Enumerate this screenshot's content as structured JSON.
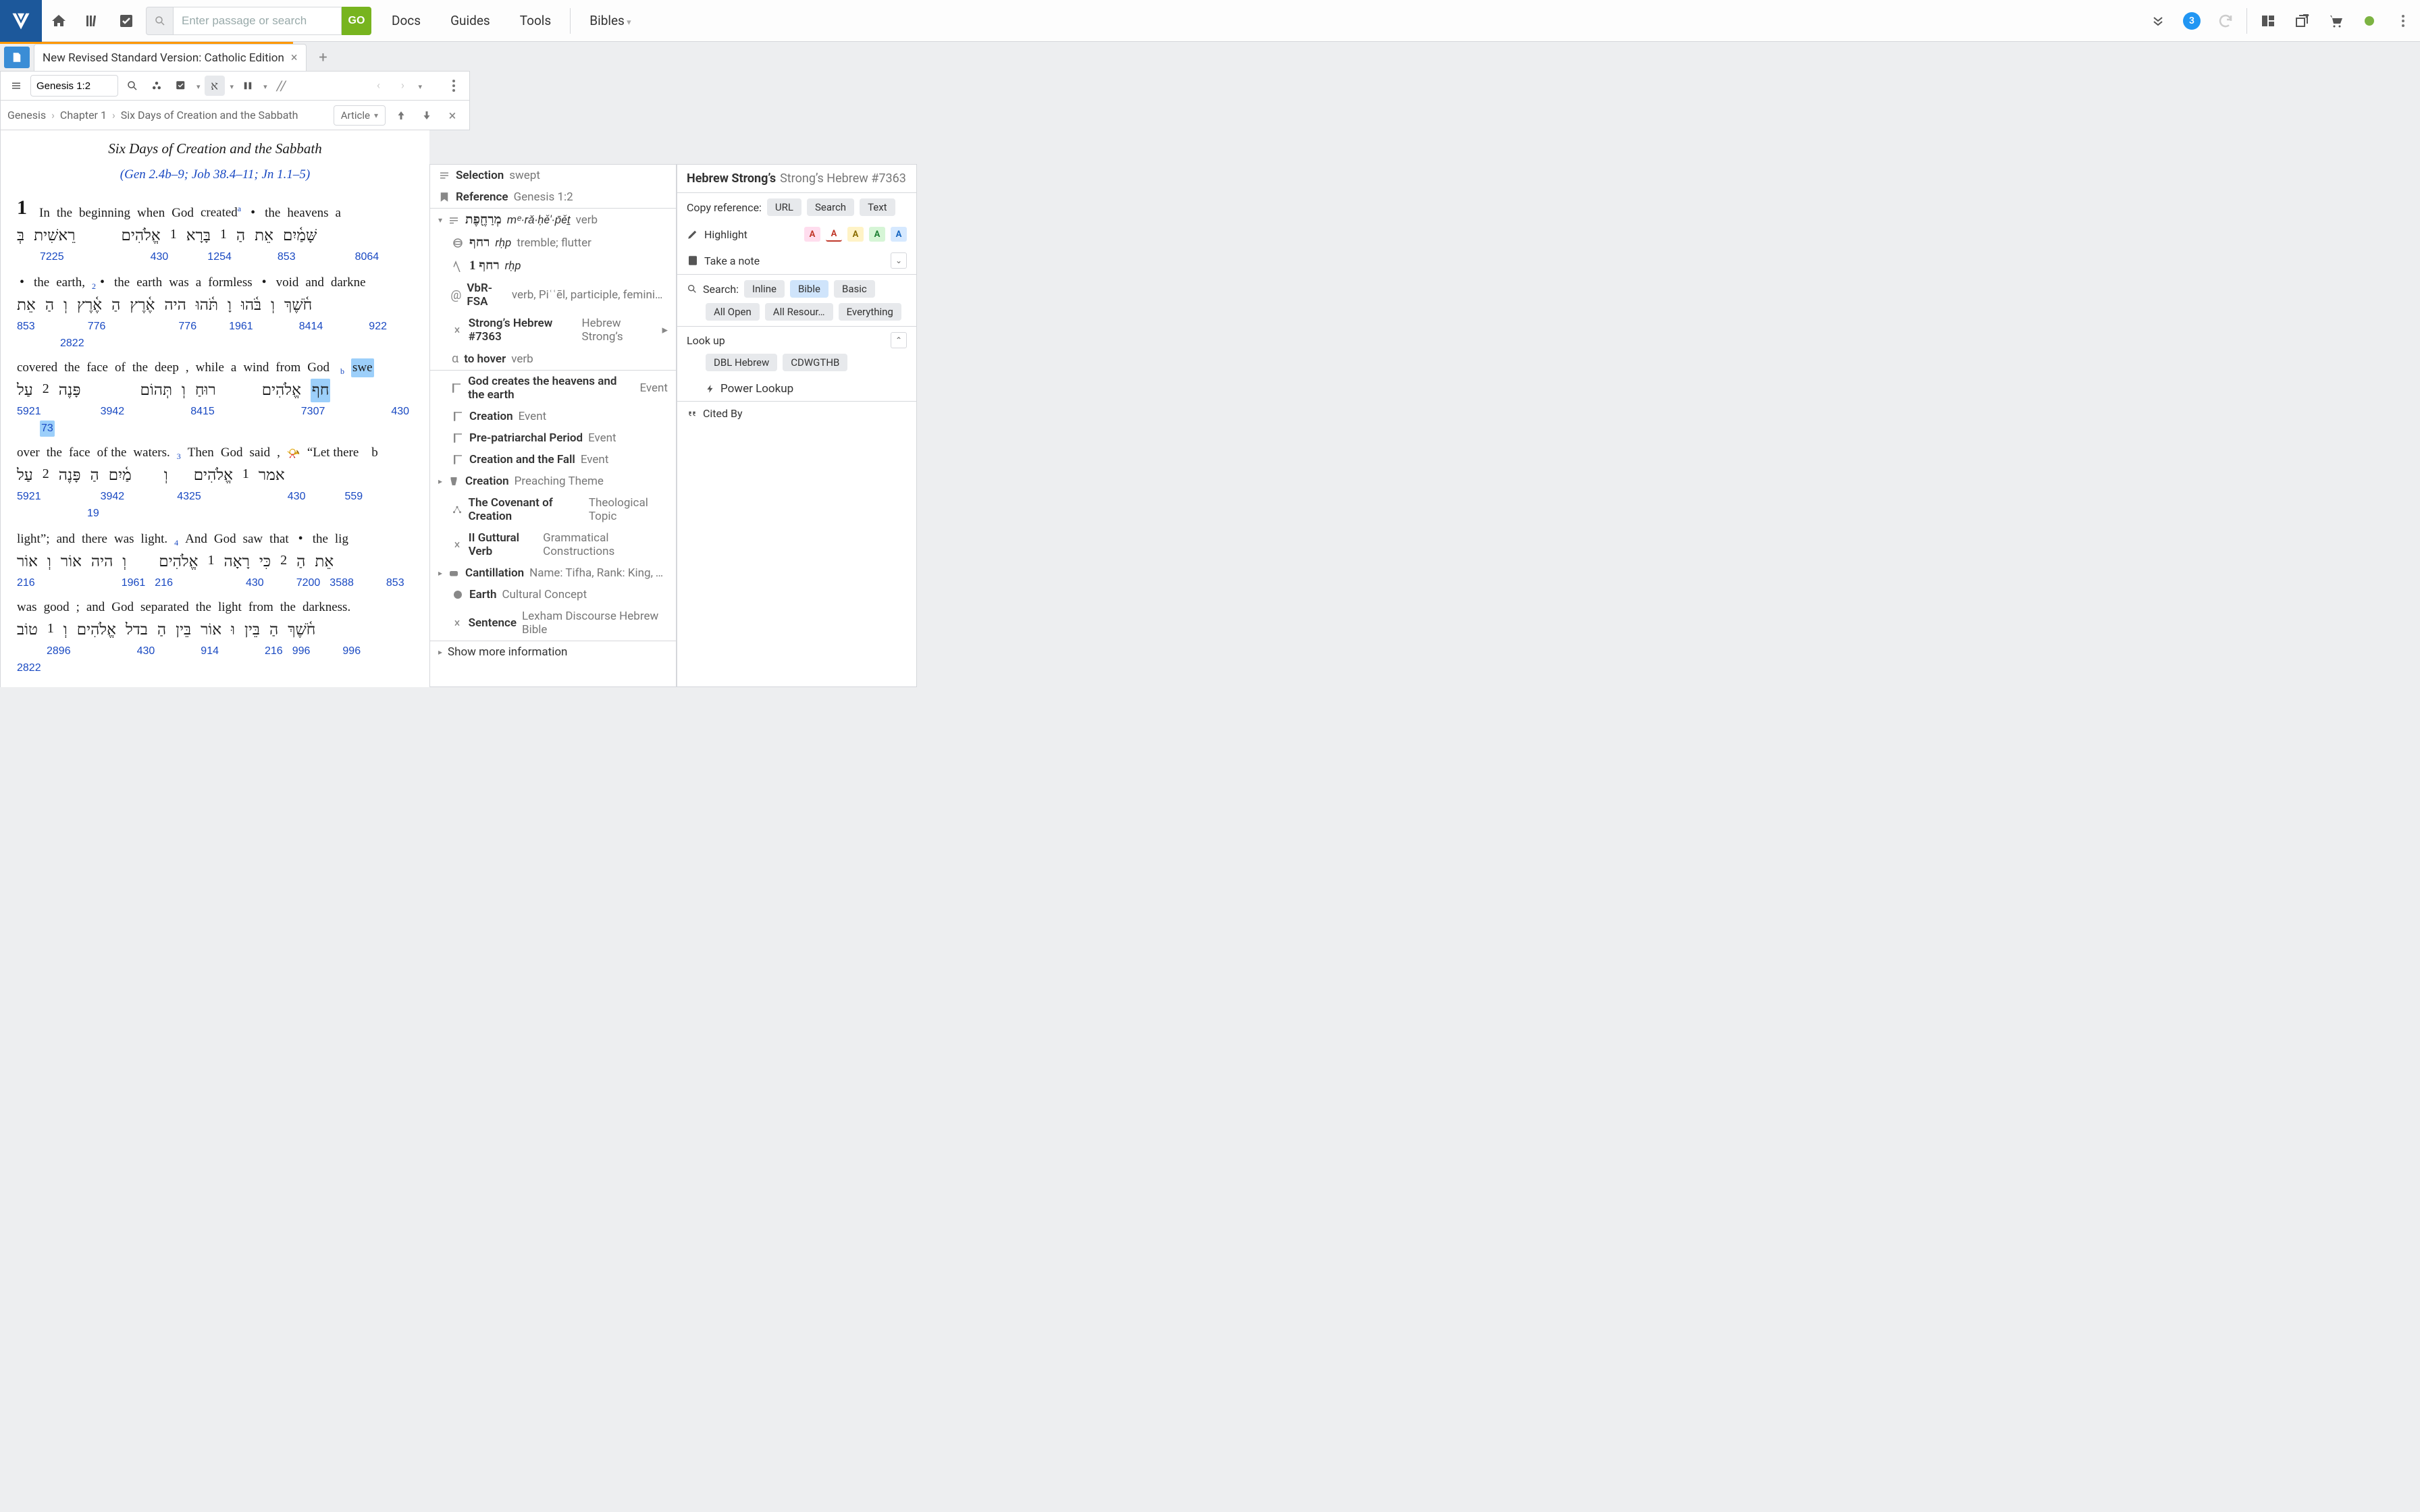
{
  "topbar": {
    "search_placeholder": "Enter passage or search",
    "go": "GO",
    "docs": "Docs",
    "guides": "Guides",
    "tools": "Tools",
    "bibles": "Bibles",
    "notif_count": "3"
  },
  "tab": {
    "title": "New Revised Standard Version: Catholic Edition"
  },
  "panel": {
    "ref": "Genesis 1:2",
    "parpar": "//"
  },
  "crumb": {
    "b": "Genesis",
    "c": "Chapter 1",
    "s": "Six Days of Creation and the Sabbath",
    "article": "Article"
  },
  "reader": {
    "title": "Six Days of Creation and the Sabbath",
    "xref_open": "(",
    "x1": "Gen 2.4b–9",
    "x1s": "; ",
    "x2": "Job 38.4–11",
    "x2s": "; ",
    "x3": "Jn 1.1–5",
    "xref_close": ")",
    "v1": "1",
    "l1": [
      "In",
      "the",
      "beginning",
      "when",
      "God",
      "created"
    ],
    "supA": "a",
    "l1b": [
      "the",
      "heavens",
      "a"
    ],
    "h1": [
      "בְּ",
      "רֵאשִׁית",
      "אֱלֹהִים",
      "1",
      "בָּרָא",
      "1",
      "הַ",
      "אֵת",
      "שָּׁמַ֫יִם"
    ],
    "n1": [
      "7225",
      "430",
      "1254",
      "853",
      "8064"
    ],
    "l2a": [
      "the",
      "earth",
      ","
    ],
    "sup2": "2",
    "l2b": [
      "the",
      "earth",
      "was",
      "a",
      "formless"
    ],
    "l2c": [
      "void",
      "and",
      "darkne"
    ],
    "h2": [
      "אֵת",
      "הַ",
      "וְ",
      "אֶ֫רֶץ",
      "הַ",
      "אֶ֫רֶץ",
      "היה",
      "תֹּ֫הוּ",
      "וָ",
      "בֹּ֫הוּ",
      "וְ",
      "חֹ֫שֶׁךְ"
    ],
    "n2": [
      "853",
      "776",
      "776",
      "1961",
      "8414",
      "922",
      "2822"
    ],
    "l3": [
      "covered",
      "the",
      "face",
      "of",
      "the",
      "deep",
      ",",
      "while",
      "a",
      "wind",
      "from",
      "God"
    ],
    "supB": "b",
    "l3hl": "swe",
    "h3": [
      "עַל",
      "2",
      "פָּנֶה",
      "תְּהוֹם",
      "וְ",
      "רוּחַ",
      "אֱלֹהִים"
    ],
    "h3hl": "חף",
    "n3": [
      "5921",
      "3942",
      "8415",
      "7307",
      "430"
    ],
    "n3hl": "73",
    "l4a": [
      "over",
      "the",
      "face",
      "of the",
      "waters."
    ],
    "sup3": "3",
    "l4b": [
      "Then",
      "God",
      "said",
      ","
    ],
    "l4c": "“Let there    b",
    "h4": [
      "עַל",
      "2",
      "פָּנֶה",
      "הַ",
      "מַ֫יִם",
      "וְ",
      "אֱלֹהִים",
      "1",
      "אמר"
    ],
    "n4": [
      "5921",
      "3942",
      "4325",
      "430",
      "559",
      "19"
    ],
    "l5a": [
      "light”;",
      "and",
      "there",
      "was",
      "light."
    ],
    "sup4": "4",
    "l5b": [
      "And",
      "God",
      "saw",
      "that"
    ],
    "l5c": [
      "the",
      "lig"
    ],
    "h5": [
      "אוֹר",
      "וְ",
      "אוֹר",
      "היה",
      "וְ",
      "אֱלֹהִים",
      "1",
      "רָאָה",
      "כִּי",
      "2",
      "הַ",
      "אֵת"
    ],
    "n5": [
      "216",
      "1961",
      "216",
      "430",
      "7200",
      "3588",
      "853"
    ],
    "l6": [
      "was",
      "good",
      ";",
      "and",
      "God",
      "separated",
      "the",
      "light",
      "from",
      "the",
      "darkness."
    ],
    "h6": [
      "טוֹב",
      "1",
      "וְ",
      "אֱלֹהִים",
      "בדל",
      "הַ",
      "בֵּין",
      "אוֹר",
      "וּ",
      "בֵּין",
      "הַ",
      "חֹ֫שֶׁךְ"
    ],
    "n6": [
      "2896",
      "430",
      "914",
      "216",
      "996",
      "996",
      "2822"
    ]
  },
  "ctx": {
    "selection_label": "Selection",
    "selection_val": "swept",
    "reference_label": "Reference",
    "reference_val": "Genesis 1:2",
    "lemma_heb": "מְרַחֶ֖פֶת",
    "lemma_translit": "mᵉ∙rǎ∙ḥě′∙p̄ěṯ",
    "lemma_pos": "verb",
    "root_heb": "רחף",
    "root_translit": "rḥp",
    "root_gloss": "tremble; flutter",
    "morph_heb": "רחף 1",
    "morph_translit": "rḥp",
    "vbr_code": "VbR-FSA",
    "vbr_val": "verb, Piʿʿēl, participle, feminine, sin…",
    "strong_label": "Strong’s Hebrew #7363",
    "strong_src": "Hebrew Strong’s",
    "hover_label": "to hover",
    "hover_pos": "verb",
    "ev1": "God creates the heavens and the earth",
    "ev1t": "Event",
    "ev2": "Creation",
    "ev2t": "Event",
    "ev3": "Pre-patriarchal Period",
    "ev3t": "Event",
    "ev4": "Creation and the Fall",
    "ev4t": "Event",
    "pt": "Creation",
    "ptt": "Preaching Theme",
    "tt": "The Covenant of Creation",
    "ttt": "Theological Topic",
    "gc": "II Guttural Verb",
    "gct": "Grammatical Constructions",
    "cant": "Cantillation",
    "cantt": "Name: Tifha, Rank: King, Type:…",
    "earth": "Earth",
    "eartht": "Cultural Concept",
    "sent": "Sentence",
    "sentt": "Lexham Discourse Hebrew Bible",
    "more": "Show more information"
  },
  "rside": {
    "t1": "Hebrew Strong’s",
    "t2": "Strong’s Hebrew #7363",
    "copyref": "Copy reference:",
    "url": "URL",
    "search": "Search",
    "text": "Text",
    "highlight": "Highlight",
    "note": "Take a note",
    "search_lbl": "Search:",
    "inline": "Inline",
    "bible": "Bible",
    "basic": "Basic",
    "allopen": "All Open",
    "allres": "All Resour…",
    "everything": "Everything",
    "lookup": "Look up",
    "dbl": "DBL Hebrew",
    "cdw": "CDWGTHB",
    "power": "Power Lookup",
    "cited": "Cited By"
  }
}
